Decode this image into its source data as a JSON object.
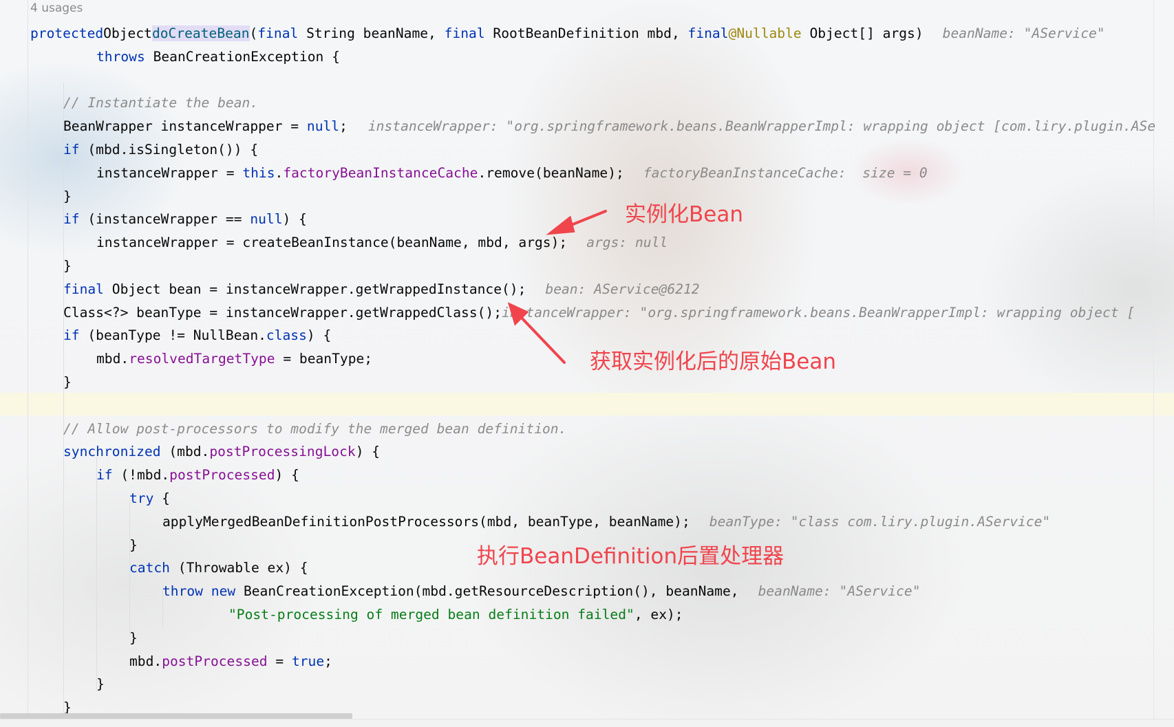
{
  "editor": {
    "usages": "4 usages",
    "colors": {
      "keyword": "#0033b3",
      "field": "#871094",
      "comment": "#8c8c8c",
      "string": "#067d17",
      "annotation": "#9e880d",
      "inline_hint": "#8a8a8a",
      "callout": "#f0454d"
    },
    "lines": [
      {
        "tokens": [
          [
            "kw",
            "protected"
          ],
          [
            "",
            "Object"
          ],
          [
            "method-decl",
            "doCreateBean"
          ],
          [
            "",
            "("
          ],
          [
            "kw",
            "final"
          ],
          [
            "",
            " String beanName, "
          ],
          [
            "kw",
            "final"
          ],
          [
            "",
            " RootBeanDefinition mbd, "
          ],
          [
            "kw",
            "final"
          ],
          [
            "",
            ""
          ],
          [
            "ann",
            "@Nullable"
          ],
          [
            "",
            " Object[] args)"
          ],
          [
            "hint",
            "beanName: \"AService\""
          ]
        ]
      },
      {
        "tokens": [
          [
            "kw",
            "throws"
          ],
          [
            "",
            " BeanCreationException {"
          ]
        ]
      },
      {
        "tokens": []
      },
      {
        "tokens": [
          [
            "cmt",
            "// Instantiate the bean."
          ]
        ]
      },
      {
        "tokens": [
          [
            "",
            "BeanWrapper instanceWrapper = "
          ],
          [
            "kw",
            "null"
          ],
          [
            "",
            ";"
          ],
          [
            "hint",
            "instanceWrapper: \"org.springframework.beans.BeanWrapperImpl: wrapping object [com.liry.plugin.ASe"
          ]
        ]
      },
      {
        "tokens": [
          [
            "kw",
            "if"
          ],
          [
            "",
            " (mbd.isSingleton()) {"
          ]
        ]
      },
      {
        "tokens": [
          [
            "",
            "instanceWrapper = "
          ],
          [
            "kw",
            "this"
          ],
          [
            "",
            "."
          ],
          [
            "fld",
            "factoryBeanInstanceCache"
          ],
          [
            "",
            ".remove(beanName);"
          ],
          [
            "hint",
            "factoryBeanInstanceCache:  size = 0"
          ]
        ]
      },
      {
        "tokens": [
          [
            "",
            "}"
          ]
        ]
      },
      {
        "tokens": [
          [
            "kw",
            "if"
          ],
          [
            "",
            " (instanceWrapper == "
          ],
          [
            "kw",
            "null"
          ],
          [
            "",
            ") {"
          ]
        ]
      },
      {
        "tokens": [
          [
            "",
            "instanceWrapper = createBeanInstance(beanName, mbd, args);"
          ],
          [
            "hint",
            "args: null"
          ]
        ]
      },
      {
        "tokens": [
          [
            "",
            "}"
          ]
        ]
      },
      {
        "tokens": [
          [
            "kw",
            "final"
          ],
          [
            "",
            " Object bean = instanceWrapper.getWrappedInstance();"
          ],
          [
            "hint",
            "bean: AService@6212"
          ]
        ]
      },
      {
        "tokens": [
          [
            "",
            "Class<?> beanType = instanceWrapper.getWrappedClass();"
          ],
          [
            "hint",
            "instanceWrapper: \"org.springframework.beans.BeanWrapperImpl: wrapping object ["
          ]
        ]
      },
      {
        "tokens": [
          [
            "kw",
            "if"
          ],
          [
            "",
            " (beanType != NullBean."
          ],
          [
            "kw",
            "class"
          ],
          [
            "",
            ") {"
          ]
        ]
      },
      {
        "tokens": [
          [
            "",
            "mbd."
          ],
          [
            "fld",
            "resolvedTargetType"
          ],
          [
            "",
            " = beanType;"
          ]
        ]
      },
      {
        "tokens": [
          [
            "",
            "}"
          ]
        ]
      },
      {
        "tokens": []
      },
      {
        "tokens": [
          [
            "cmt",
            "// Allow post-processors to modify the merged bean definition."
          ]
        ]
      },
      {
        "tokens": [
          [
            "kw",
            "synchronized"
          ],
          [
            "",
            " (mbd."
          ],
          [
            "fld",
            "postProcessingLock"
          ],
          [
            "",
            ") {"
          ]
        ]
      },
      {
        "tokens": [
          [
            "kw",
            "if"
          ],
          [
            "",
            " (!mbd."
          ],
          [
            "fld",
            "postProcessed"
          ],
          [
            "",
            ") {"
          ]
        ]
      },
      {
        "tokens": [
          [
            "kw",
            "try"
          ],
          [
            "",
            " {"
          ]
        ]
      },
      {
        "tokens": [
          [
            "",
            "applyMergedBeanDefinitionPostProcessors(mbd, beanType, beanName);"
          ],
          [
            "hint",
            "beanType: \"class com.liry.plugin.AService\""
          ]
        ]
      },
      {
        "tokens": [
          [
            "",
            "}"
          ]
        ]
      },
      {
        "tokens": [
          [
            "kw",
            "catch"
          ],
          [
            "",
            " (Throwable ex) {"
          ]
        ]
      },
      {
        "tokens": [
          [
            "kw",
            "throw"
          ],
          [
            "",
            ""
          ],
          [
            "kw",
            "new"
          ],
          [
            "",
            " BeanCreationException(mbd.getResourceDescription(), beanName,"
          ],
          [
            "hint",
            "beanName: \"AService\""
          ]
        ]
      },
      {
        "tokens": [
          [
            "str",
            "\"Post-processing of merged bean definition failed\""
          ],
          [
            "",
            ", ex);"
          ]
        ]
      },
      {
        "tokens": [
          [
            "",
            "}"
          ]
        ]
      },
      {
        "tokens": [
          [
            "",
            "mbd."
          ],
          [
            "fld",
            "postProcessed"
          ],
          [
            "",
            " = "
          ],
          [
            "kw",
            "true"
          ],
          [
            "",
            ";"
          ]
        ]
      },
      {
        "tokens": [
          [
            "",
            "}"
          ]
        ]
      },
      {
        "tokens": [
          [
            "",
            "}"
          ]
        ]
      }
    ]
  },
  "callouts": {
    "instantiate": "实例化Bean",
    "get_raw_bean": "获取实例化后的原始Bean",
    "post_processor": "执行BeanDefinition后置处理器"
  }
}
